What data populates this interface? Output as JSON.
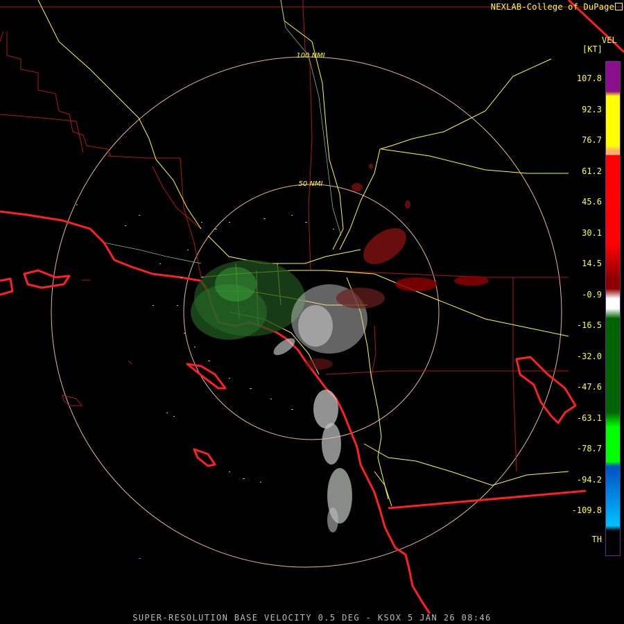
{
  "header": {
    "credit": "NEXLAB-College of DuPage"
  },
  "rings": [
    {
      "label": "100 NMI"
    },
    {
      "label": "50 NMI"
    }
  ],
  "legend": {
    "title": "VEL",
    "unit": "[KT]",
    "ticks": [
      "107.8",
      "92.3",
      "76.7",
      "61.2",
      "45.6",
      "30.1",
      "14.5",
      "-0.9",
      "-16.5",
      "-32.0",
      "-47.6",
      "-63.1",
      "-78.7",
      "-94.2",
      "-109.8"
    ],
    "th_label": "TH",
    "colors": [
      "#8a0f8a",
      "#ffff00",
      "#ffb070",
      "#ff0000",
      "#8b0000",
      "#ffffff",
      "#006400",
      "#00ff00",
      "#0050c0",
      "#00c0ff",
      "#000000"
    ]
  },
  "footer": {
    "caption": "SUPER-RESOLUTION BASE VELOCITY 0.5 DEG - KSOX 5 JAN 26 08:46"
  },
  "colors": {
    "coast": "#ff2020",
    "highway": "#ffff33",
    "county": "#b01818",
    "ring": "#e8b89a"
  }
}
